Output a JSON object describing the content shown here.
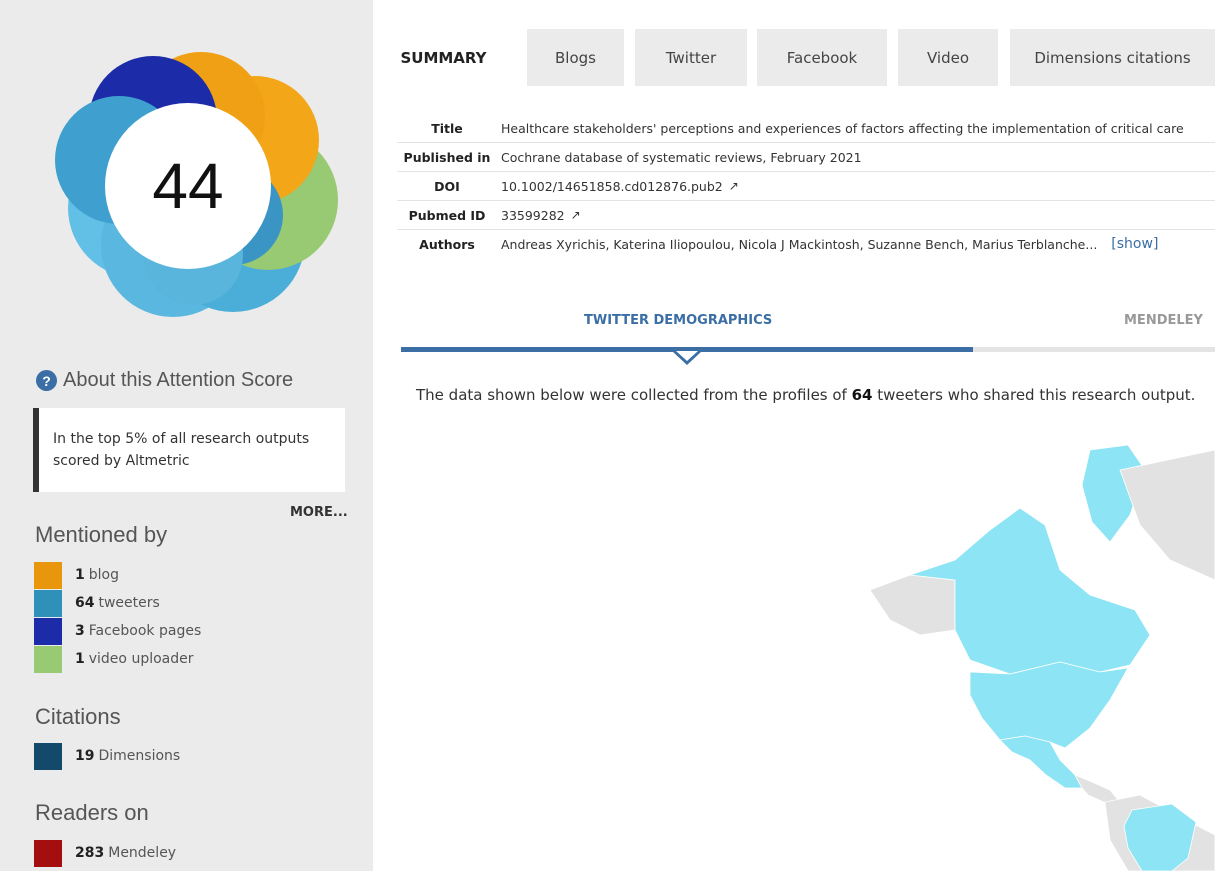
{
  "score": {
    "value": "44"
  },
  "about": {
    "title": "About this Attention Score",
    "icon": "question-icon",
    "text": "In the top 5% of all research outputs scored by Altmetric",
    "more_label": "MORE..."
  },
  "mentioned_by": {
    "title": "Mentioned by",
    "items": [
      {
        "count": "1",
        "label": "blog",
        "color": "#e8960c"
      },
      {
        "count": "64",
        "label": "tweeters",
        "color": "#2f90b9"
      },
      {
        "count": "3",
        "label": "Facebook pages",
        "color": "#1c2ca8"
      },
      {
        "count": "1",
        "label": "video uploader",
        "color": "#98c973"
      }
    ]
  },
  "citations": {
    "title": "Citations",
    "items": [
      {
        "count": "19",
        "label": "Dimensions",
        "color": "#134a6b"
      }
    ]
  },
  "readers": {
    "title": "Readers on",
    "items": [
      {
        "count": "283",
        "label": "Mendeley",
        "color": "#a50e0e"
      }
    ]
  },
  "tabs": [
    {
      "label": "SUMMARY",
      "active": true
    },
    {
      "label": "Blogs",
      "active": false
    },
    {
      "label": "Twitter",
      "active": false
    },
    {
      "label": "Facebook",
      "active": false
    },
    {
      "label": "Video",
      "active": false
    },
    {
      "label": "Dimensions citations",
      "active": false
    }
  ],
  "details": {
    "title_label": "Title",
    "title_value": "Healthcare stakeholders' perceptions and experiences of factors affecting the implementation of critical care",
    "published_label": "Published in",
    "published_value": "Cochrane database of systematic reviews, February 2021",
    "doi_label": "DOI",
    "doi_value": "10.1002/14651858.cd012876.pub2",
    "pubmed_label": "Pubmed ID",
    "pubmed_value": "33599282",
    "authors_label": "Authors",
    "authors_value": "Andreas Xyrichis, Katerina Iliopoulou, Nicola J Mackintosh, Suzanne Bench, Marius Terblanche...",
    "show_label": "[show]"
  },
  "demographics": {
    "tab_twitter": "TWITTER DEMOGRAPHICS",
    "tab_mendeley": "MENDELEY",
    "desc_prefix": "The data shown below were collected from the profiles of",
    "desc_count": "64",
    "desc_suffix": "tweeters who shared this research output."
  },
  "colors": {
    "accent": "#3a6ea5",
    "map_land": "#8ce4f4",
    "map_other": "#e2e2e2"
  }
}
